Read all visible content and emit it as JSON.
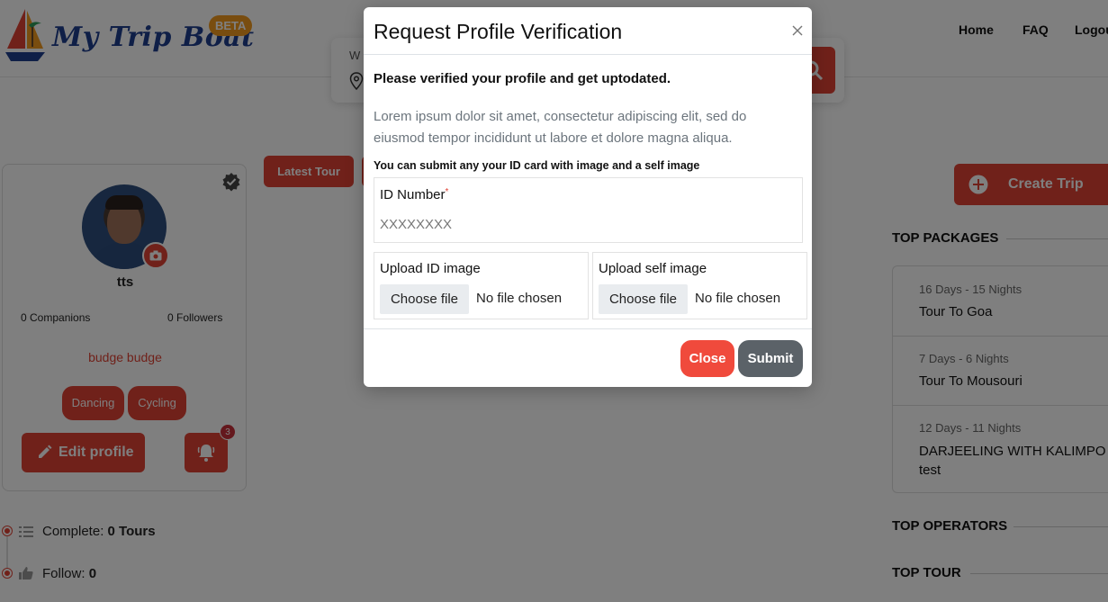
{
  "header": {
    "logo_text": "My Trip Boat",
    "beta_label": "BETA",
    "nav": [
      {
        "label": "Home"
      },
      {
        "label": "FAQ"
      },
      {
        "label": "Logout"
      }
    ],
    "search": {
      "where_label": "W",
      "icon": "search-icon"
    }
  },
  "profile": {
    "username": "tts",
    "companions": "0 Companions",
    "followers": "0 Followers",
    "location": "budge budge",
    "tags": [
      "Dancing",
      "Cycling"
    ],
    "edit_label": "Edit profile",
    "notification_count": "3"
  },
  "timeline": [
    {
      "label": "Complete:",
      "value": "0 Tours",
      "icon": "list-icon"
    },
    {
      "label": "Follow:",
      "value": "0",
      "icon": "thumbs-up-icon"
    }
  ],
  "main": {
    "latest_tour_label": "Latest Tour"
  },
  "sidebar": {
    "create_trip_label": "Create Trip",
    "top_packages_title": "TOP PACKAGES",
    "packages": [
      {
        "duration": "16 Days - 15 Nights",
        "name": "Tour To Goa"
      },
      {
        "duration": "7 Days - 6 Nights",
        "name": "Tour To Mousouri"
      },
      {
        "duration": "12 Days - 11 Nights",
        "name": "DARJEELING WITH KALIMPO",
        "name2": "test"
      }
    ],
    "top_operators_title": "TOP OPERATORS",
    "top_tour_title": "TOP TOUR"
  },
  "modal": {
    "title": "Request Profile Verification",
    "subtitle": "Please verified your profile and get uptodated.",
    "lorem": "Lorem ipsum dolor sit amet, consectetur adipiscing elit, sed do eiusmod tempor incididunt ut labore et dolore magna aliqua.",
    "note": "You can submit any your ID card with image and a self image",
    "id_label": "ID Number",
    "id_required_mark": "*",
    "id_placeholder": "XXXXXXXX",
    "upload_id_label": "Upload ID image",
    "upload_self_label": "Upload self image",
    "choose_file_label": "Choose file",
    "no_file_label": "No file chosen",
    "close_label": "Close",
    "submit_label": "Submit"
  },
  "colors": {
    "accent": "#e04234",
    "brand_blue": "#1f3e8f",
    "beta": "#f29a1e",
    "submit": "#5b6268"
  }
}
